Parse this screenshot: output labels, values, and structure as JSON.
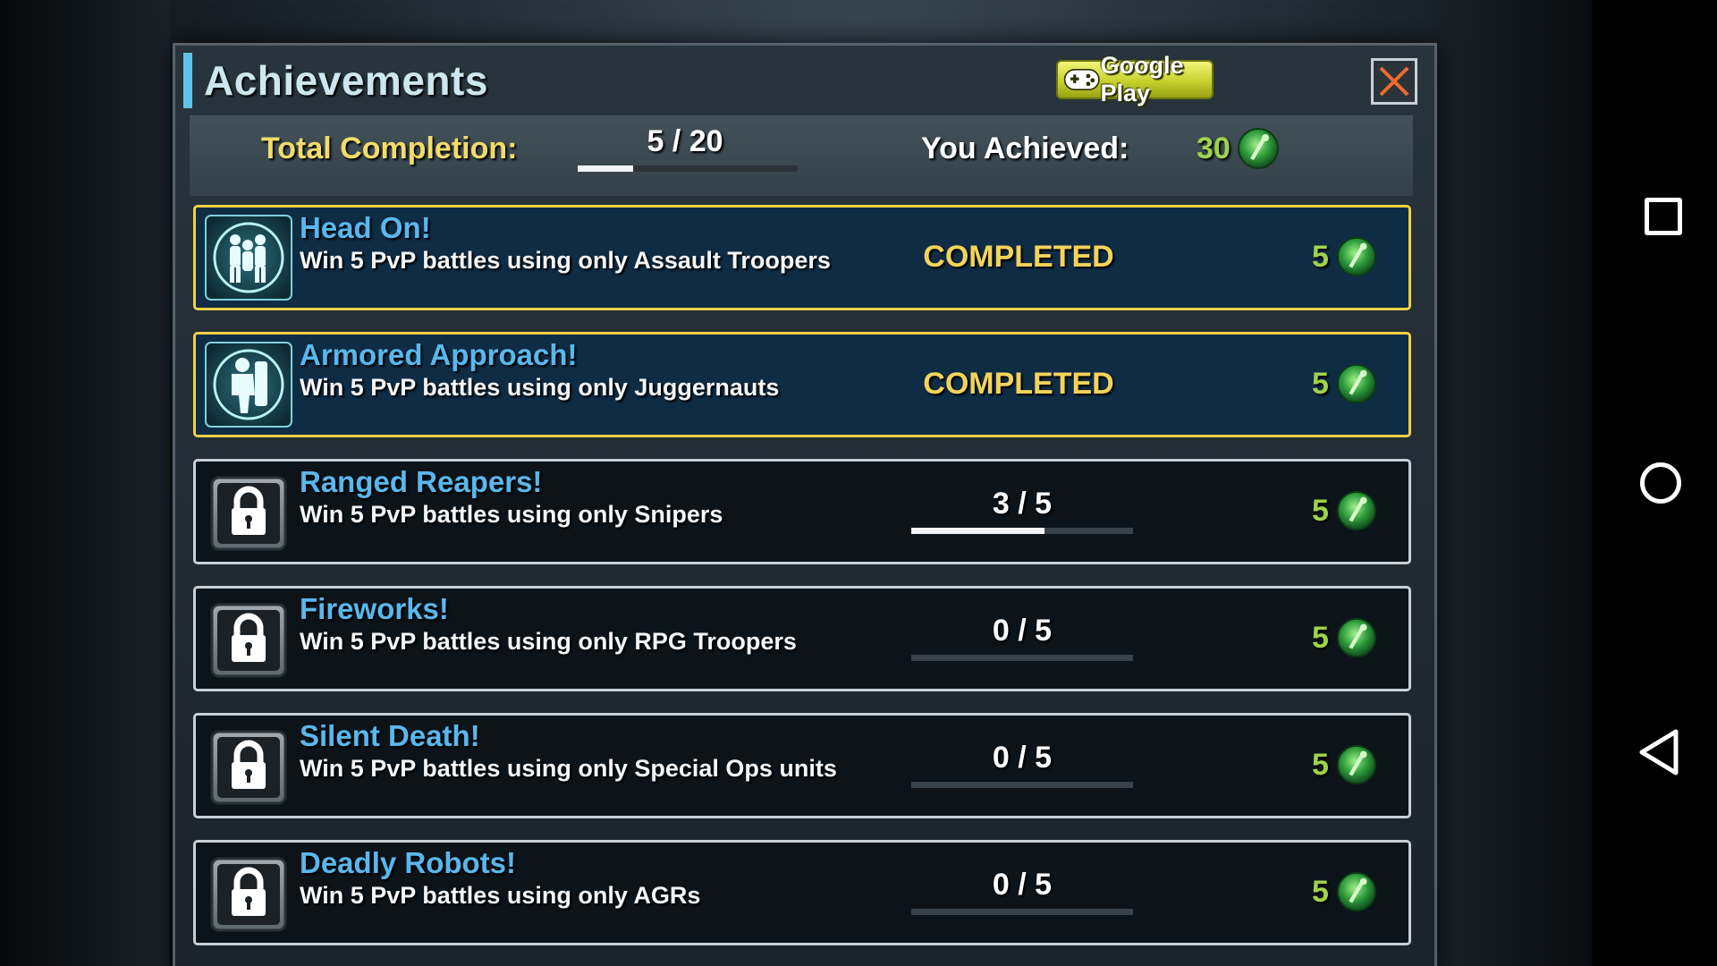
{
  "panel": {
    "title": "Achievements",
    "google_play_label": "Google Play",
    "close_label": "Close"
  },
  "summary": {
    "total_label": "Total Completion:",
    "total_progress": "5 / 20",
    "total_fraction": 0.25,
    "achieved_label": "You Achieved:",
    "achieved_points": "30"
  },
  "achievements": [
    {
      "title": "Head On!",
      "description": "Win 5 PvP battles using only Assault Troopers",
      "status": "COMPLETED",
      "progress": "",
      "fraction": 1.0,
      "reward": "5",
      "icon": "assault-troopers-icon"
    },
    {
      "title": "Armored Approach!",
      "description": "Win 5 PvP battles using only Juggernauts",
      "status": "COMPLETED",
      "progress": "",
      "fraction": 1.0,
      "reward": "5",
      "icon": "juggernaut-icon"
    },
    {
      "title": "Ranged Reapers!",
      "description": "Win 5 PvP battles using only Snipers",
      "status": "",
      "progress": "3 / 5",
      "fraction": 0.6,
      "reward": "5",
      "icon": "lock-icon"
    },
    {
      "title": "Fireworks!",
      "description": "Win 5 PvP battles using only RPG Troopers",
      "status": "",
      "progress": "0 / 5",
      "fraction": 0.0,
      "reward": "5",
      "icon": "lock-icon"
    },
    {
      "title": "Silent Death!",
      "description": "Win 5 PvP battles using only Special Ops units",
      "status": "",
      "progress": "0 / 5",
      "fraction": 0.0,
      "reward": "5",
      "icon": "lock-icon"
    },
    {
      "title": "Deadly Robots!",
      "description": "Win 5 PvP battles using only AGRs",
      "status": "",
      "progress": "0 / 5",
      "fraction": 0.0,
      "reward": "5",
      "icon": "lock-icon"
    }
  ],
  "colors": {
    "title_accent": "#5fc3ea",
    "completed_border": "#f2d046",
    "completed_text": "#f3d35a",
    "reward_green": "#9fd34a",
    "achievement_title": "#5ab7ec"
  },
  "system_nav": {
    "recents_icon": "square-icon",
    "home_icon": "circle-icon",
    "back_icon": "triangle-back-icon"
  }
}
